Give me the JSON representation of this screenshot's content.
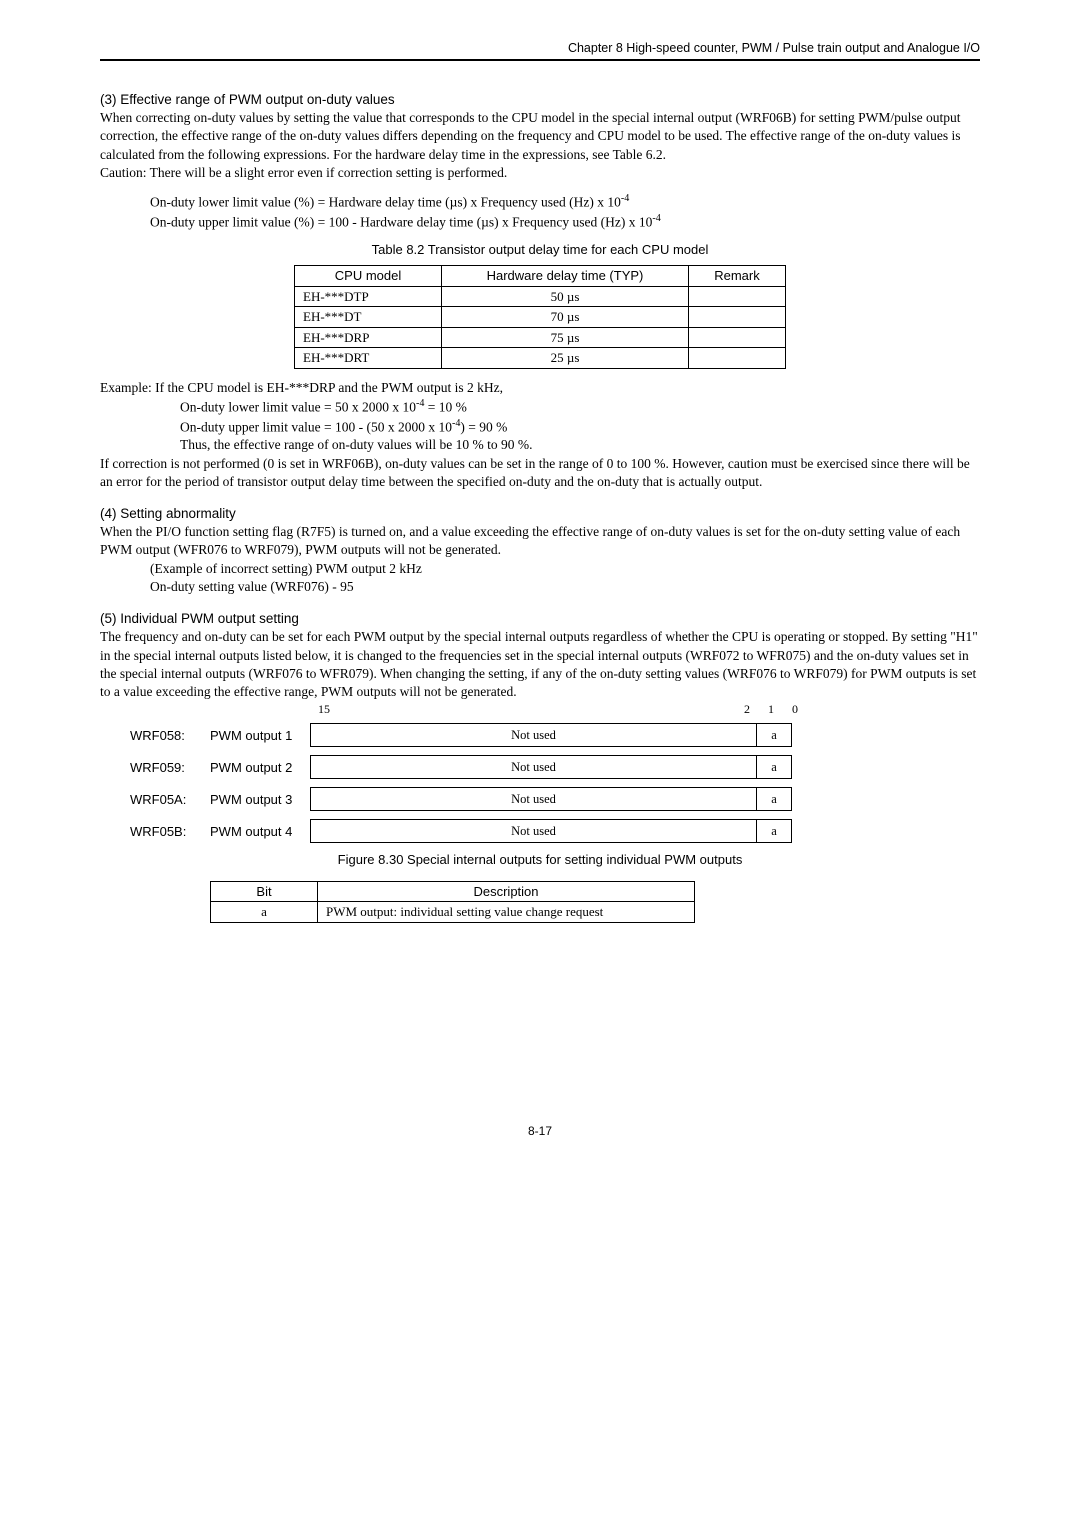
{
  "header": "Chapter 8  High-speed counter, PWM / Pulse train output and Analogue I/O",
  "sec3": {
    "title": "(3)   Effective range of PWM output on-duty values",
    "p1": "When correcting on-duty values by setting the value that corresponds to the CPU model in the special internal output (WRF06B) for setting PWM/pulse output correction, the effective range of the on-duty values differs depending on the frequency and CPU model to be used. The effective range of the on-duty values is calculated from the following expressions. For the hardware delay time in the expressions, see Table 6.2.",
    "p2": "Caution:   There will be a slight error even if correction setting is performed.",
    "formula1_a": "On-duty lower limit value (%) = Hardware delay time (µs) x Frequency used (Hz) x 10",
    "formula1_sup": "-4",
    "formula2_a": "On-duty upper limit value (%) = 100 - Hardware delay time (µs) x Frequency used (Hz) x 10",
    "formula2_sup": "-4",
    "tableCaption": "Table 8.2 Transistor output delay time for each CPU model",
    "th1": "CPU model",
    "th2": "Hardware delay time (TYP)",
    "th3": "Remark",
    "rows": [
      {
        "m": "EH-***DTP",
        "d": "50 µs",
        "r": ""
      },
      {
        "m": "EH-***DT",
        "d": "70 µs",
        "r": ""
      },
      {
        "m": "EH-***DRP",
        "d": "75 µs",
        "r": ""
      },
      {
        "m": "EH-***DRT",
        "d": "25 µs",
        "r": ""
      }
    ],
    "ex_intro": "Example: If the CPU model is EH-***DRP and the PWM output is 2 kHz,",
    "ex_l1a": "On-duty lower limit value = 50 x 2000 x 10",
    "ex_l1_sup": "-4",
    "ex_l1b": " = 10 %",
    "ex_l2a": "On-duty upper limit value = 100 - (50 x 2000 x 10",
    "ex_l2_sup": "-4",
    "ex_l2b": ") = 90 %",
    "ex_l3": "Thus, the effective range of on-duty values will be 10 % to 90 %.",
    "p3": "If correction is not performed (0 is set in WRF06B), on-duty values can be set in the range of 0 to 100 %. However, caution must be exercised since there will be an error for the period of transistor output delay time between the specified on-duty and the on-duty that is actually output."
  },
  "sec4": {
    "title": "(4)   Setting abnormality",
    "p1": "When the PI/O function setting flag (R7F5) is turned on, and a value exceeding the effective range of on-duty values is set for the on-duty setting value of each PWM output (WFR076 to WRF079), PWM outputs will not be generated.",
    "p2": "(Example of incorrect setting) PWM output 2 kHz",
    "p3": "On-duty setting value (WRF076) - 95"
  },
  "sec5": {
    "title": "(5)   Individual PWM output setting",
    "p1": "The frequency and on-duty can be set for each PWM output by the special internal outputs regardless of whether the CPU is operating or stopped. By setting \"H1\" in the special internal outputs listed below, it is changed to the frequencies set in the special internal outputs (WRF072 to WFR075) and the on-duty values set in the special internal outputs (WRF076 to WFR079). When changing the setting, if any of the on-duty setting values (WRF076 to WRF079) for PWM outputs is set to a value exceeding the effective range, PWM outputs will not be generated.",
    "axis15": "15",
    "axis2": "2",
    "axis1": "1",
    "axis0": "0",
    "regs": [
      {
        "code": "WRF058:",
        "label": "PWM output 1",
        "nu": "Not used",
        "a": "a"
      },
      {
        "code": "WRF059:",
        "label": "PWM output 2",
        "nu": "Not used",
        "a": "a"
      },
      {
        "code": "WRF05A:",
        "label": "PWM output 3",
        "nu": "Not used",
        "a": "a"
      },
      {
        "code": "WRF05B:",
        "label": "PWM output 4",
        "nu": "Not used",
        "a": "a"
      }
    ],
    "figCaption": "Figure 8.30 Special internal outputs for setting individual PWM outputs",
    "desc_th1": "Bit",
    "desc_th2": "Description",
    "desc_td1": "a",
    "desc_td2": "PWM output: individual setting value change request"
  },
  "pageNum": "8-17"
}
